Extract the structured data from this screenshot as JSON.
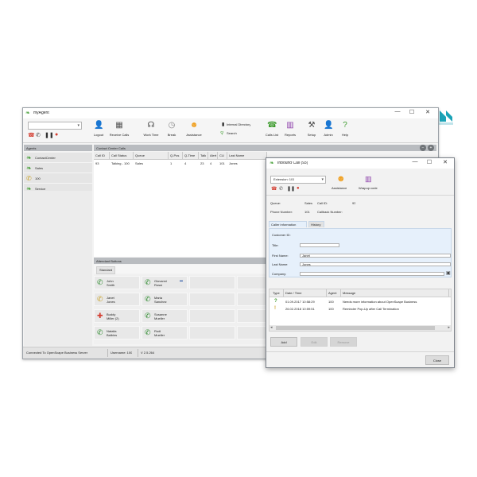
{
  "main_window": {
    "title": "myAgent",
    "minimize": "—",
    "maximize": "☐",
    "close": "✕",
    "toolbar": [
      {
        "label": "Logout",
        "icon": "logout-icon",
        "glyph": "👤"
      },
      {
        "label": "Receive Calls",
        "icon": "receive-calls-icon",
        "glyph": "▦"
      },
      {
        "label": "Work Time",
        "icon": "work-time-icon",
        "glyph": "☊"
      },
      {
        "label": "Break",
        "icon": "break-icon",
        "glyph": "◷"
      },
      {
        "label": "Assistance",
        "icon": "assistance-icon",
        "glyph": "☻"
      },
      {
        "label": "Calls List",
        "icon": "calls-list-icon",
        "glyph": "☎"
      },
      {
        "label": "Reports",
        "icon": "reports-icon",
        "glyph": "▥"
      },
      {
        "label": "Setup",
        "icon": "setup-icon",
        "glyph": "⚒"
      },
      {
        "label": "Admin",
        "icon": "admin-icon",
        "glyph": "👤"
      },
      {
        "label": "Help",
        "icon": "help-icon",
        "glyph": "?"
      }
    ],
    "internal_directory": "Internal Directory",
    "search": "Search",
    "agents_header": "Agents",
    "agents": [
      "ContactCenter",
      "Sales",
      "100",
      "Service"
    ],
    "contact_center_calls_header": "Contact Center Calls",
    "calls_columns": [
      "Call ID",
      "Call Status",
      "Queue",
      "Q-Pos",
      "Q-Time",
      "Talk",
      "Alert",
      "CLI",
      "Last Name"
    ],
    "calls_rows": [
      [
        "93",
        "Talking - 100",
        "Sales",
        "1",
        "4",
        "23",
        "4",
        "101",
        "Jones"
      ]
    ],
    "attendant_header": "Attendant Buttons",
    "attendant_tab": "Standard",
    "attendant_buttons": [
      {
        "name": "John\nSmith",
        "icon": "phone-handset-icon",
        "glyph": "✆",
        "color": "#2e8b2e"
      },
      {
        "name": "Giovanni\nRossi",
        "icon": "phone-handset-icon",
        "glyph": "✆",
        "color": "#2e8b2e"
      },
      {
        "name": "Janet\nJones",
        "icon": "phone-handset-icon",
        "glyph": "✆",
        "color": "#c9a227"
      },
      {
        "name": "Maria\nSanchez",
        "icon": "phone-handset-icon",
        "glyph": "✆",
        "color": "#2e8b2e"
      },
      {
        "name": "Buddy\nMiller (2)",
        "icon": "phone-busy-icon",
        "glyph": "✚",
        "color": "#d33c2f"
      },
      {
        "name": "Susanne\nMueller",
        "icon": "phone-handset-icon",
        "glyph": "✆",
        "color": "#2e8b2e"
      },
      {
        "name": "Natalia\nBalbins",
        "icon": "phone-handset-icon",
        "glyph": "✆",
        "color": "#2e8b2e"
      },
      {
        "name": "Rudi\nMueller",
        "icon": "phone-handset-icon",
        "glyph": "✆",
        "color": "#2e8b2e"
      }
    ],
    "status_bar": {
      "connection": "Connected To OpenScape Business Server",
      "username": "Username: 100",
      "version": "V 2.5.264"
    }
  },
  "popup": {
    "title": "Inbound Call (93)",
    "minimize": "—",
    "maximize": "☐",
    "close": "✕",
    "extension_select": "Extension: 101",
    "assistance": "Assistance",
    "wrapup_code": "Wrapup code",
    "queue_label": "Queue:",
    "queue_value": "Sales",
    "call_id_label": "Call ID:",
    "call_id_value": "93",
    "phone_label": "Phone Number:",
    "phone_value": "101",
    "callback_label": "Callback Number:",
    "tabs": [
      "Caller information",
      "History"
    ],
    "customer_id_label": "Customer ID:",
    "title_label": "Title:",
    "first_name_label": "First Name:",
    "first_name_value": "Janet",
    "last_name_label": "Last Name:",
    "last_name_value": "Jones",
    "company_label": "Company:",
    "message_columns": [
      "Type",
      "Date / Time",
      "Agent",
      "Message"
    ],
    "messages": [
      {
        "type_glyph": "?",
        "date": "01.09.2017 10:58:29",
        "agent": "100",
        "message": "Needs more information about OpenScape Business"
      },
      {
        "type_glyph": "!",
        "date": "26.02.2018 10:59:51",
        "agent": "100",
        "message": "Reminder Pop-Up after Call Termination"
      }
    ],
    "buttons": {
      "add": "Add",
      "edit": "Edit",
      "remove": "Remove",
      "close": "Close"
    }
  },
  "colors": {
    "accent_green": "#3d9b2d",
    "header_gray": "#b9bcc0",
    "selection_blue": "#cfe3f7",
    "logo_teal": "#1ba3b7"
  }
}
